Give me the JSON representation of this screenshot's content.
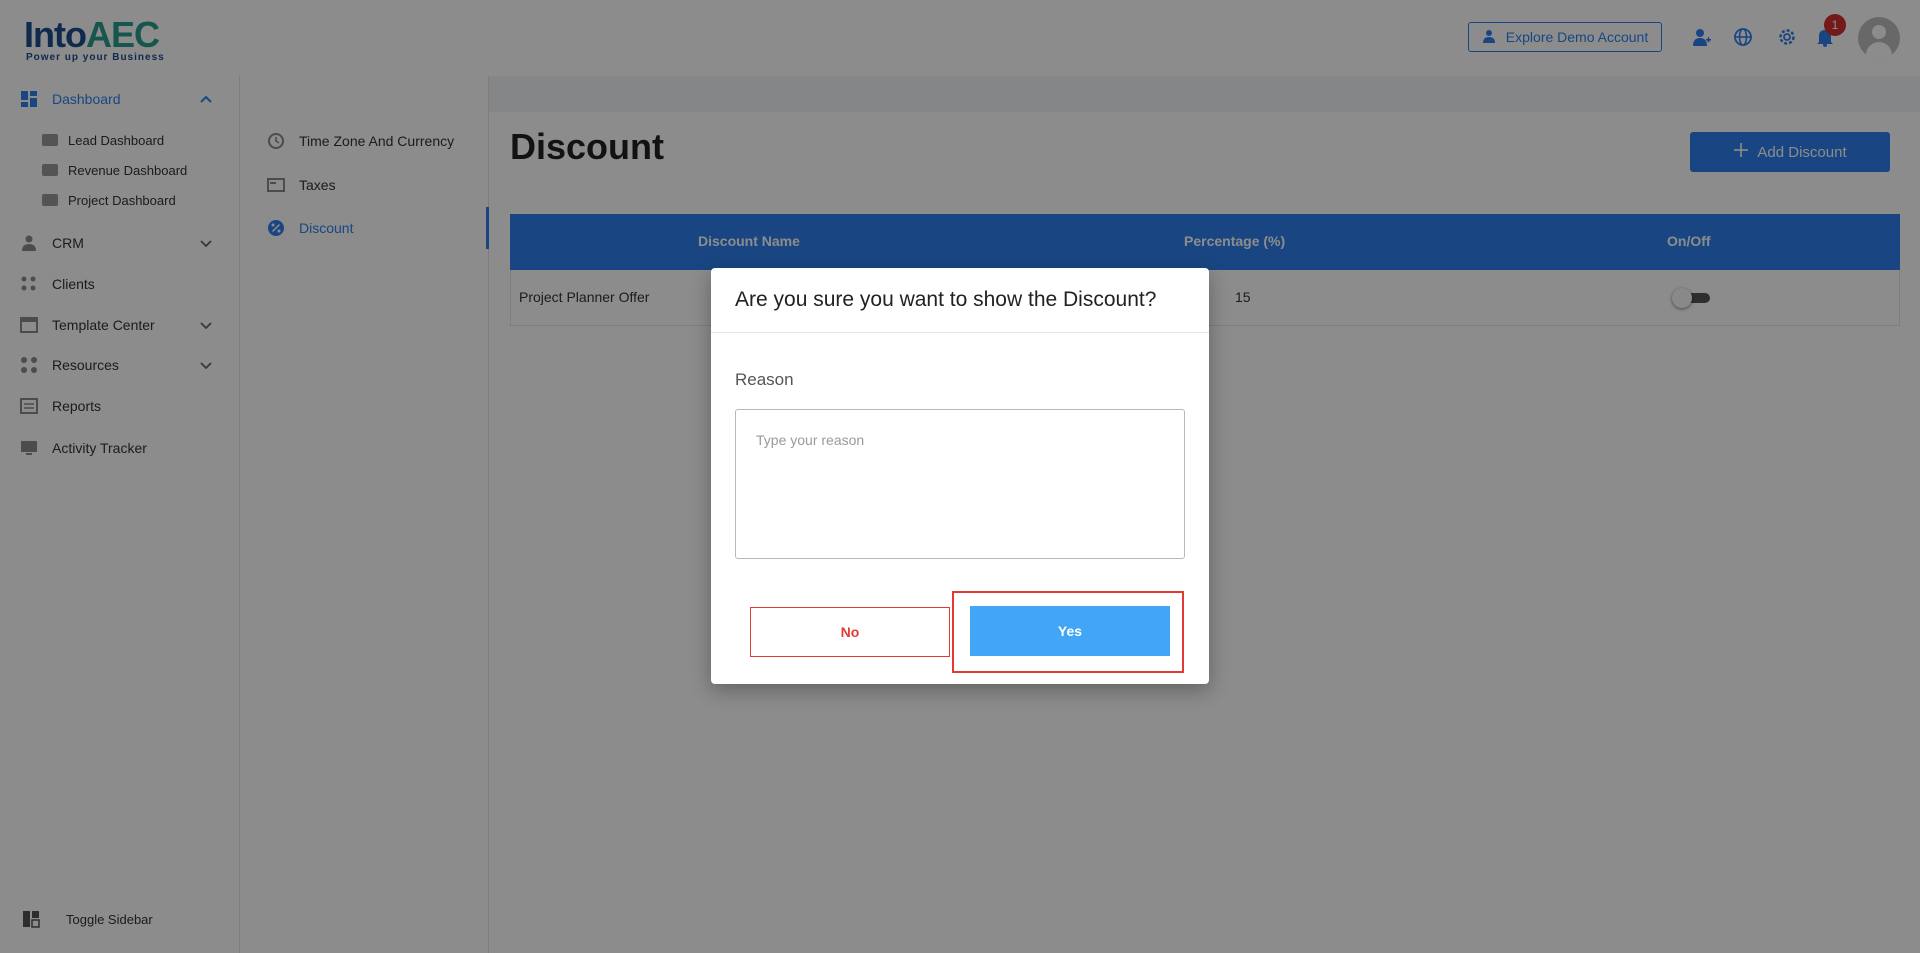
{
  "header": {
    "logo_main": "Into",
    "logo_accent": "AEC",
    "logo_tagline": "Power up your Business",
    "demo_button": "Explore Demo Account",
    "notification_count": "1",
    "icons": [
      "user-add-icon",
      "globe-icon",
      "gear-icon",
      "bell-icon",
      "avatar-icon"
    ]
  },
  "sidebar": {
    "dashboard": "Dashboard",
    "dashboard_sub": [
      "Lead Dashboard",
      "Revenue Dashboard",
      "Project Dashboard"
    ],
    "crm": "CRM",
    "clients": "Clients",
    "template_center": "Template Center",
    "resources": "Resources",
    "reports": "Reports",
    "activity_tracker": "Activity Tracker",
    "toggle_sidebar": "Toggle Sidebar"
  },
  "settings_menu": {
    "items": [
      "Time Zone And Currency",
      "Taxes",
      "Discount"
    ],
    "active": "Discount"
  },
  "page": {
    "title": "Discount",
    "add_button": "Add Discount"
  },
  "table": {
    "columns": [
      "Discount Name",
      "Percentage (%)",
      "On/Off"
    ],
    "rows": [
      {
        "name": "Project Planner Offer",
        "percentage": "15",
        "on": false
      }
    ]
  },
  "modal": {
    "title": "Are you sure you want to show the Discount?",
    "reason_label": "Reason",
    "reason_placeholder": "Type your reason",
    "reason_value": "",
    "no_label": "No",
    "yes_label": "Yes"
  },
  "colors": {
    "primary": "#2f80ed",
    "yes_button": "#42a5f5",
    "danger": "#e53935"
  }
}
